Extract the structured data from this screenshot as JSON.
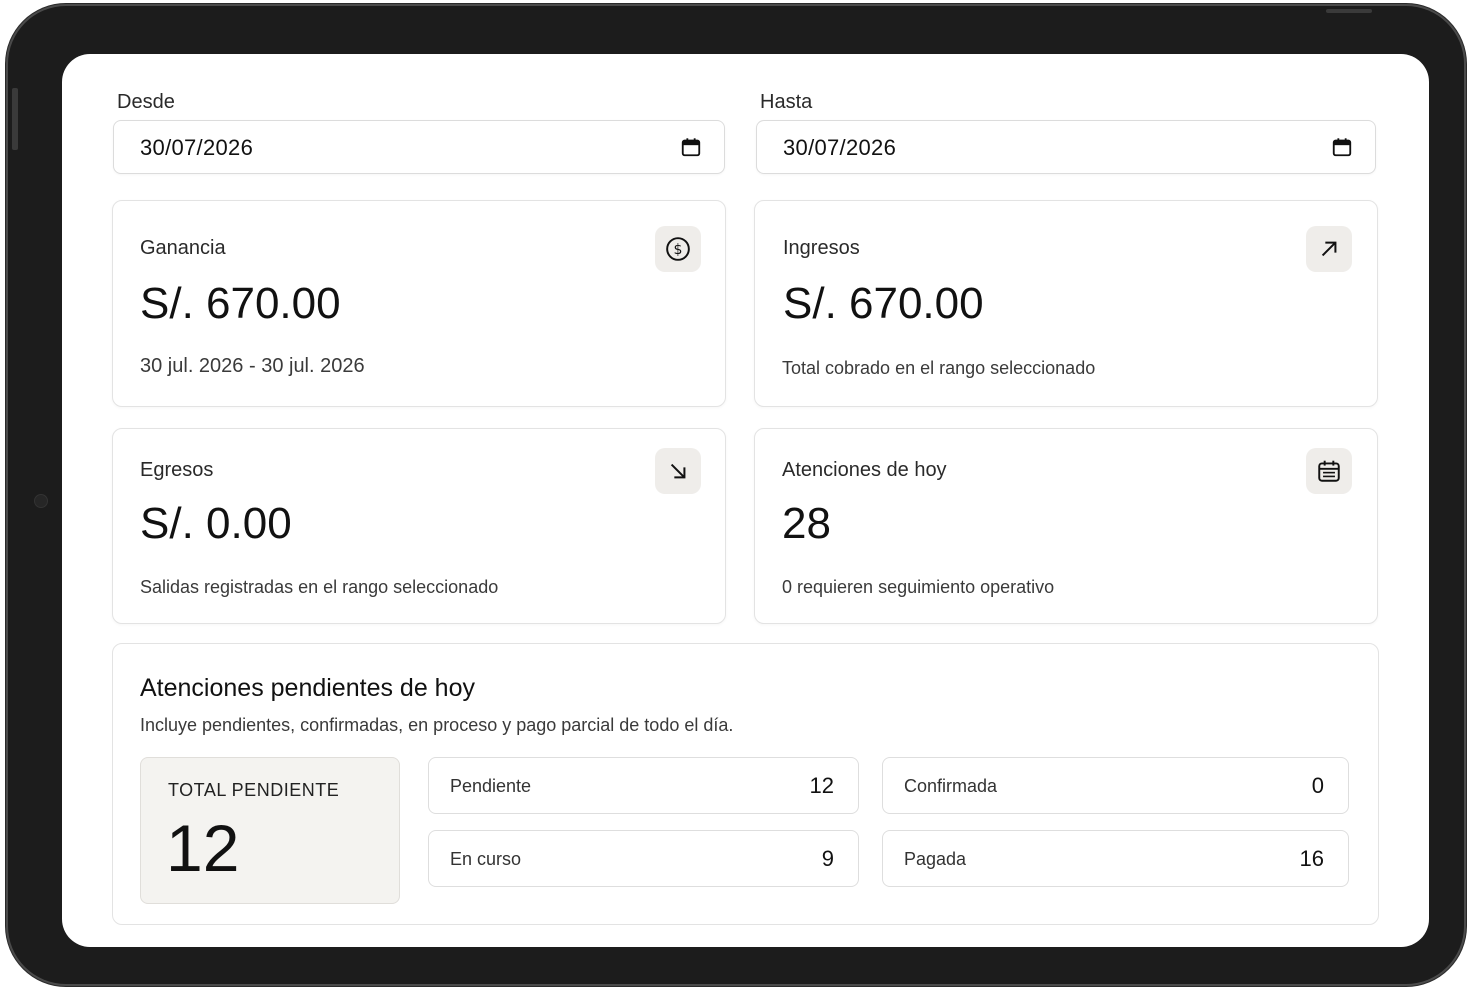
{
  "filters": {
    "from": {
      "label": "Desde",
      "value": "30/07/2026"
    },
    "to": {
      "label": "Hasta",
      "value": "30/07/2026"
    }
  },
  "cards": {
    "profit": {
      "title": "Ganancia",
      "value": "S/. 670.00",
      "subtitle": "30 jul. 2026 - 30 jul. 2026",
      "icon": "dollar-circle-icon"
    },
    "income": {
      "title": "Ingresos",
      "value": "S/. 670.00",
      "subtitle": "Total cobrado en el rango seleccionado",
      "icon": "arrow-up-right-icon"
    },
    "expenses": {
      "title": "Egresos",
      "value": "S/. 0.00",
      "subtitle": "Salidas registradas en el rango seleccionado",
      "icon": "arrow-down-right-icon"
    },
    "appointments": {
      "title": "Atenciones de hoy",
      "value": "28",
      "subtitle": "0 requieren seguimiento operativo",
      "icon": "calendar-icon"
    }
  },
  "pending": {
    "title": "Atenciones pendientes de hoy",
    "description": "Incluye pendientes, confirmadas, en proceso y pago parcial de todo el día.",
    "total_label": "TOTAL PENDIENTE",
    "total_value": "12",
    "stats": [
      {
        "label": "Pendiente",
        "value": "12"
      },
      {
        "label": "Confirmada",
        "value": "0"
      },
      {
        "label": "En curso",
        "value": "9"
      },
      {
        "label": "Pagada",
        "value": "16"
      }
    ]
  },
  "colors": {
    "icon_bg": "#efedea",
    "total_bg": "#f4f3f0",
    "frame": "#1c1c1c"
  }
}
